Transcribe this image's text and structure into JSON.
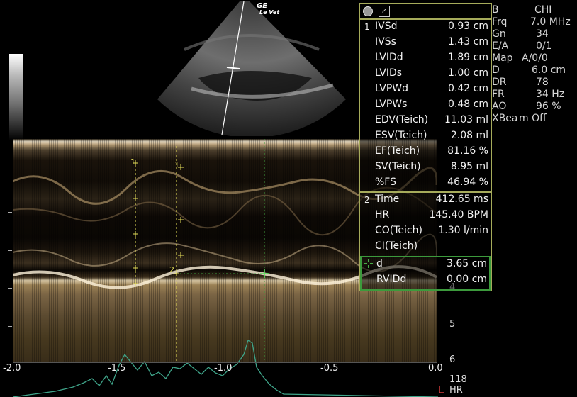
{
  "logo": {
    "brand": "GE",
    "sub": "Le Vet"
  },
  "panel": {
    "group1_number": "1",
    "group2_number": "2",
    "measurements_1": [
      {
        "label": "IVSd",
        "value": "0.93 cm"
      },
      {
        "label": "IVSs",
        "value": "1.43 cm"
      },
      {
        "label": "LVIDd",
        "value": "1.89 cm"
      },
      {
        "label": "LVIDs",
        "value": "1.00 cm"
      },
      {
        "label": "LVPWd",
        "value": "0.42 cm"
      },
      {
        "label": "LVPWs",
        "value": "0.48 cm"
      },
      {
        "label": "EDV(Teich)",
        "value": "11.03 ml"
      },
      {
        "label": "ESV(Teich)",
        "value": "2.08 ml"
      },
      {
        "label": "EF(Teich)",
        "value": "81.16 %"
      },
      {
        "label": "SV(Teich)",
        "value": "8.95 ml"
      },
      {
        "label": "%FS",
        "value": "46.94 %"
      }
    ],
    "measurements_2": [
      {
        "label": "Time",
        "value": "412.65 ms"
      },
      {
        "label": "HR",
        "value": "145.40 BPM"
      },
      {
        "label": "CO(Teich)",
        "value": "1.30 l/min"
      },
      {
        "label": "CI(Teich)",
        "value": ""
      }
    ],
    "active": [
      {
        "label": "d",
        "value": "3.65 cm"
      },
      {
        "label": "RVIDd",
        "value": "0.00 cm"
      }
    ]
  },
  "info": [
    {
      "key": "B",
      "value": "CHI"
    },
    {
      "key": "Frq",
      "value": "7.0 MHz"
    },
    {
      "key": "Gn",
      "value": "34"
    },
    {
      "key": "E/A",
      "value": "0/1"
    },
    {
      "key": "Map",
      "value": "A/0/0"
    },
    {
      "key": "D",
      "value": "6.0 cm"
    },
    {
      "key": "DR",
      "value": "78"
    },
    {
      "key": "FR",
      "value": "34 Hz"
    },
    {
      "key": "AO",
      "value": "96 %"
    },
    {
      "key": "XBea",
      "value": "m Off"
    }
  ],
  "depth_labels": [
    "4",
    "5",
    "6"
  ],
  "time_axis": [
    "-2.0",
    "-1.5",
    "-1.0",
    "-0.5",
    "0.0"
  ],
  "marker_labels": {
    "a": "1",
    "b": "1",
    "c": "2"
  },
  "hr_readout": {
    "value": "118",
    "label": "HR"
  },
  "colors": {
    "panel_border": "#a6ab5b",
    "active_border": "#3c9a3c",
    "caliper": "#e6e05a",
    "ecg": "#3fa58a"
  }
}
